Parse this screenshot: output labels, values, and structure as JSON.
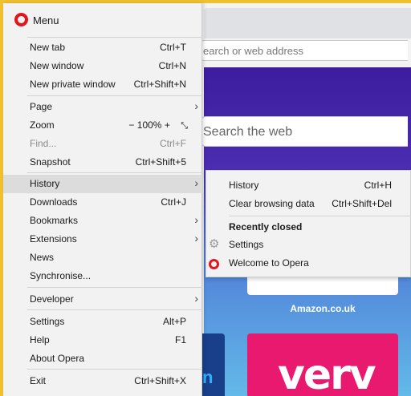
{
  "background": {
    "address_placeholder": "earch or web address",
    "search_placeholder": "Search the web",
    "tile_caption": "Amazon.co.uk",
    "tile_verv": "verv",
    "tile_left_letter": "n"
  },
  "menu": {
    "title": "Menu",
    "items": [
      {
        "label": "New tab",
        "shortcut": "Ctrl+T"
      },
      {
        "label": "New window",
        "shortcut": "Ctrl+N"
      },
      {
        "label": "New private window",
        "shortcut": "Ctrl+Shift+N"
      },
      {
        "label": "Page",
        "shortcut": ""
      },
      {
        "label": "Zoom",
        "shortcut": ""
      },
      {
        "label": "Find...",
        "shortcut": "Ctrl+F"
      },
      {
        "label": "Snapshot",
        "shortcut": "Ctrl+Shift+5"
      },
      {
        "label": "History",
        "shortcut": ""
      },
      {
        "label": "Downloads",
        "shortcut": "Ctrl+J"
      },
      {
        "label": "Bookmarks",
        "shortcut": ""
      },
      {
        "label": "Extensions",
        "shortcut": ""
      },
      {
        "label": "News",
        "shortcut": ""
      },
      {
        "label": "Synchronise...",
        "shortcut": ""
      },
      {
        "label": "Developer",
        "shortcut": ""
      },
      {
        "label": "Settings",
        "shortcut": "Alt+P"
      },
      {
        "label": "Help",
        "shortcut": "F1"
      },
      {
        "label": "About Opera",
        "shortcut": ""
      },
      {
        "label": "Exit",
        "shortcut": "Ctrl+Shift+X"
      }
    ],
    "zoom": {
      "minus": "−",
      "value": "100%",
      "plus": "+",
      "fullscreen": "⤡"
    }
  },
  "history_submenu": {
    "items": [
      {
        "label": "History",
        "shortcut": "Ctrl+H"
      },
      {
        "label": "Clear browsing data",
        "shortcut": "Ctrl+Shift+Del"
      }
    ],
    "recently_closed_heading": "Recently closed",
    "recent": [
      {
        "label": "Settings",
        "icon": "gear-icon"
      },
      {
        "label": "Welcome to Opera",
        "icon": "opera-icon"
      }
    ]
  },
  "colors": {
    "accent": "#e0161e",
    "frame": "#f0c030"
  }
}
